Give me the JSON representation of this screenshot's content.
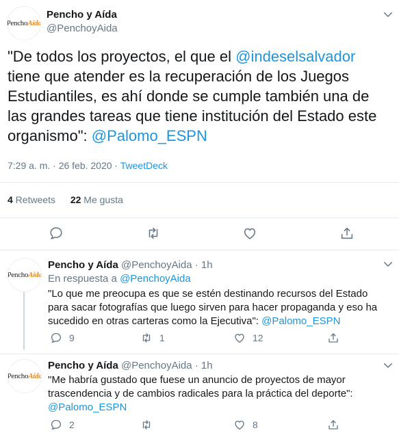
{
  "main_tweet": {
    "avatar_logo": {
      "part1": "Pencho",
      "part2": "Aída"
    },
    "name": "Pencho y Aída",
    "handle": "@PenchoyAida",
    "text_1": "\"De todos los proyectos, el que el ",
    "mention_1": "@indeselsalvador",
    "text_2": " tiene que atender es la recuperación de los Juegos Estudiantiles, es ahí donde se cumple también una de las grandes tareas que tiene institución del Estado este organismo\": ",
    "mention_2": "@Palomo_ESPN",
    "time": "7:29 a. m. · 26 feb. 2020 · ",
    "source": "TweetDeck",
    "retweets_count": "4",
    "retweets_label": " Retweets",
    "likes_count": "22",
    "likes_label": " Me gusta"
  },
  "replies": [
    {
      "name": "Pencho y Aída",
      "handle_time": " @PenchoyAida · 1h",
      "in_reply_label": "En respuesta a ",
      "in_reply_handle": "@PenchoyAida",
      "text": "\"Lo que me preocupa es que se estén destinando recursos del Estado para sacar fotografías que luego sirven para hacer propaganda y eso ha sucedido en otras carteras como la Ejecutiva\": ",
      "mention": "@Palomo_ESPN",
      "replies_count": "9",
      "retweets_count": "1",
      "likes_count": "12"
    },
    {
      "name": "Pencho y Aída",
      "handle_time": " @PenchoyAida · 1h",
      "text": "\"Me habría gustado que fuese un anuncio de proyectos de mayor trascendencia y de cambios radicales para la práctica del deporte\": ",
      "mention": "@Palomo_ESPN",
      "replies_count": "2",
      "retweets_count": "",
      "likes_count": "8"
    }
  ],
  "icons": {
    "reply": "speech-bubble-icon",
    "retweet": "retweet-arrows-icon",
    "like": "heart-icon",
    "share": "share-upload-icon",
    "more": "chevron-down-icon"
  },
  "colors": {
    "link": "#1b95e0",
    "secondary": "#657786",
    "divider": "#e6ecf0",
    "logo_accent": "#e88a1a"
  }
}
